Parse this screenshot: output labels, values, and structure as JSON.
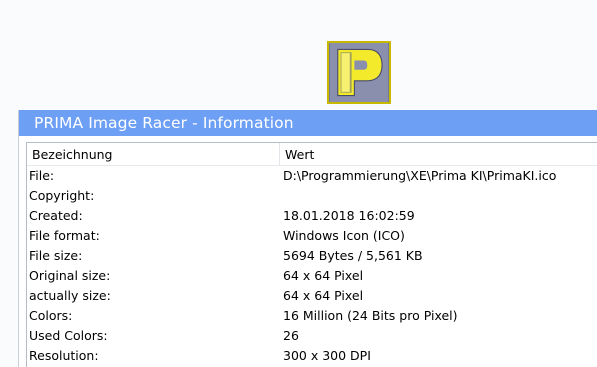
{
  "window": {
    "title": "PRIMA Image Racer - Information"
  },
  "logo": {
    "icon": "prima-p-logo-icon",
    "background_color": "#8a8fae",
    "letter_color": "#f2ea2a",
    "border_color": "#c8b800"
  },
  "colors": {
    "titlebar": "#6d9ff4",
    "titlebar_text": "#ffffff"
  },
  "table": {
    "columns": [
      "Bezeichnung",
      "Wert"
    ],
    "rows": [
      {
        "label": "File:",
        "value": "D:\\Programmierung\\XE\\Prima KI\\PrimaKI.ico"
      },
      {
        "label": "Copyright:",
        "value": ""
      },
      {
        "label": "Created:",
        "value": "18.01.2018 16:02:59"
      },
      {
        "label": "File format:",
        "value": "Windows Icon (ICO)"
      },
      {
        "label": "File size:",
        "value": "5694 Bytes / 5,561 KB"
      },
      {
        "label": "Original size:",
        "value": "64 x 64 Pixel"
      },
      {
        "label": "actually size:",
        "value": "64 x 64 Pixel"
      },
      {
        "label": "Colors:",
        "value": "16 Million (24 Bits pro Pixel)"
      },
      {
        "label": "Used Colors:",
        "value": "26"
      },
      {
        "label": "Resolution:",
        "value": "300 x 300 DPI"
      }
    ]
  }
}
